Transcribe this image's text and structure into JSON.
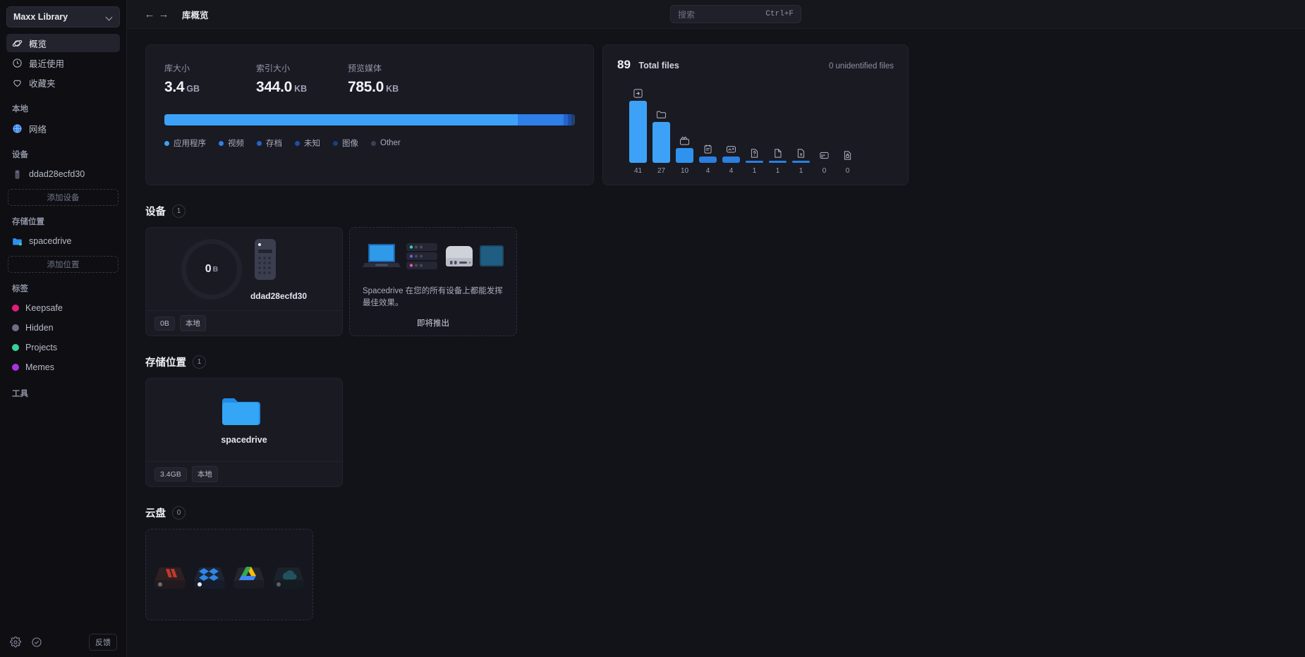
{
  "sidebar": {
    "library": {
      "name": "Maxx Library",
      "chevron_icon": "chevron-down-icon"
    },
    "nav": [
      {
        "label": "概览",
        "icon": "planet-icon",
        "active": true
      },
      {
        "label": "最近使用",
        "icon": "clock-icon",
        "active": false
      },
      {
        "label": "收藏夹",
        "icon": "heart-icon",
        "active": false
      }
    ],
    "local": {
      "title": "本地",
      "items": [
        {
          "label": "网络",
          "icon": "globe-icon"
        }
      ]
    },
    "devices": {
      "title": "设备",
      "items": [
        {
          "label": "ddad28ecfd30",
          "icon": "server-icon"
        }
      ],
      "add_label": "添加设备"
    },
    "locations": {
      "title": "存储位置",
      "items": [
        {
          "label": "spacedrive",
          "icon": "folder-icon"
        }
      ],
      "add_label": "添加位置"
    },
    "tags": {
      "title": "标签",
      "items": [
        {
          "label": "Keepsafe",
          "color": "#e01e78"
        },
        {
          "label": "Hidden",
          "color": "#6e6f84"
        },
        {
          "label": "Projects",
          "color": "#36d399"
        },
        {
          "label": "Memes",
          "color": "#aa33e0"
        }
      ]
    },
    "tools": {
      "title": "工具"
    },
    "bottom": {
      "settings_icon": "gear-icon",
      "status_icon": "check-circle-icon",
      "feedback_label": "反馈"
    }
  },
  "topbar": {
    "back_icon": "arrow-left-icon",
    "forward_icon": "arrow-right-icon",
    "breadcrumb": "库概览",
    "search": {
      "placeholder": "搜索",
      "shortcut": "Ctrl+F"
    }
  },
  "stats": {
    "items": [
      {
        "label": "库大小",
        "value": "3.4",
        "unit": "GB"
      },
      {
        "label": "索引大小",
        "value": "344.0",
        "unit": "KB"
      },
      {
        "label": "预览媒体",
        "value": "785.0",
        "unit": "KB"
      }
    ],
    "usage_bar": [
      {
        "name": "应用程序",
        "percent": 86.0,
        "color": "#3da2f7"
      },
      {
        "name": "视频",
        "percent": 11.2,
        "color": "#2e7fe8"
      },
      {
        "name": "存档",
        "percent": 1.0,
        "color": "#2563cc"
      },
      {
        "name": "未知",
        "percent": 0.9,
        "color": "#1d4ea8"
      },
      {
        "name": "图像",
        "percent": 0.5,
        "color": "#17407f"
      },
      {
        "name": "Other",
        "percent": 0.4,
        "color": "#3b3f57"
      }
    ],
    "legend": [
      {
        "label": "应用程序",
        "color": "#3da2f7"
      },
      {
        "label": "视频",
        "color": "#2e7fe8"
      },
      {
        "label": "存档",
        "color": "#2563cc"
      },
      {
        "label": "未知",
        "color": "#1d4ea8"
      },
      {
        "label": "图像",
        "color": "#17407f"
      },
      {
        "label": "Other",
        "color": "#3b3f57"
      }
    ]
  },
  "chart_data": {
    "type": "bar",
    "title": "Total files",
    "total": "89",
    "total_label": "Total files",
    "unidentified_label": "0 unidentified files",
    "categories": [
      "executable",
      "folder",
      "video",
      "book",
      "image",
      "unknown",
      "document",
      "certificate",
      "archive",
      "encrypted"
    ],
    "icons": [
      "executable-file-icon",
      "folder-icon",
      "video-file-icon",
      "book-file-icon",
      "image-file-icon",
      "unknown-file-icon",
      "document-file-icon",
      "certificate-file-icon",
      "archive-file-icon",
      "encrypted-file-icon"
    ],
    "values": [
      41,
      27,
      10,
      4,
      4,
      1,
      1,
      1,
      0,
      0
    ],
    "xlabel": "",
    "ylabel": "",
    "ylim": [
      0,
      41
    ],
    "grid": false,
    "legend": "none",
    "bar_color": "#3da2f7"
  },
  "devices_section": {
    "title": "设备",
    "count": "1",
    "card": {
      "ring_value": "0",
      "ring_unit": "B",
      "device_name": "ddad28ecfd30",
      "device_icon": "server-tower-icon",
      "pills": [
        "0B",
        "本地"
      ]
    },
    "promo": {
      "text": "Spacedrive 在您的所有设备上都能发挥最佳效果。",
      "cta": "即将推出",
      "icons": [
        "laptop-icon",
        "server-rack-icon",
        "mac-mini-icon",
        "external-drive-icon"
      ]
    }
  },
  "locations_section": {
    "title": "存储位置",
    "count": "1",
    "card": {
      "folder_icon": "folder-icon",
      "name": "spacedrive",
      "pills": [
        "3.4GB",
        "本地"
      ]
    }
  },
  "cloud_section": {
    "title": "云盘",
    "count": "0",
    "drives": [
      {
        "name": "red-drive-icon",
        "color": "#c03a3a"
      },
      {
        "name": "dropbox-drive-icon",
        "color": "#2e7fe8"
      },
      {
        "name": "google-drive-icon",
        "color": "#34a853"
      },
      {
        "name": "cloud-drive-icon",
        "color": "#2a5f78"
      }
    ]
  }
}
